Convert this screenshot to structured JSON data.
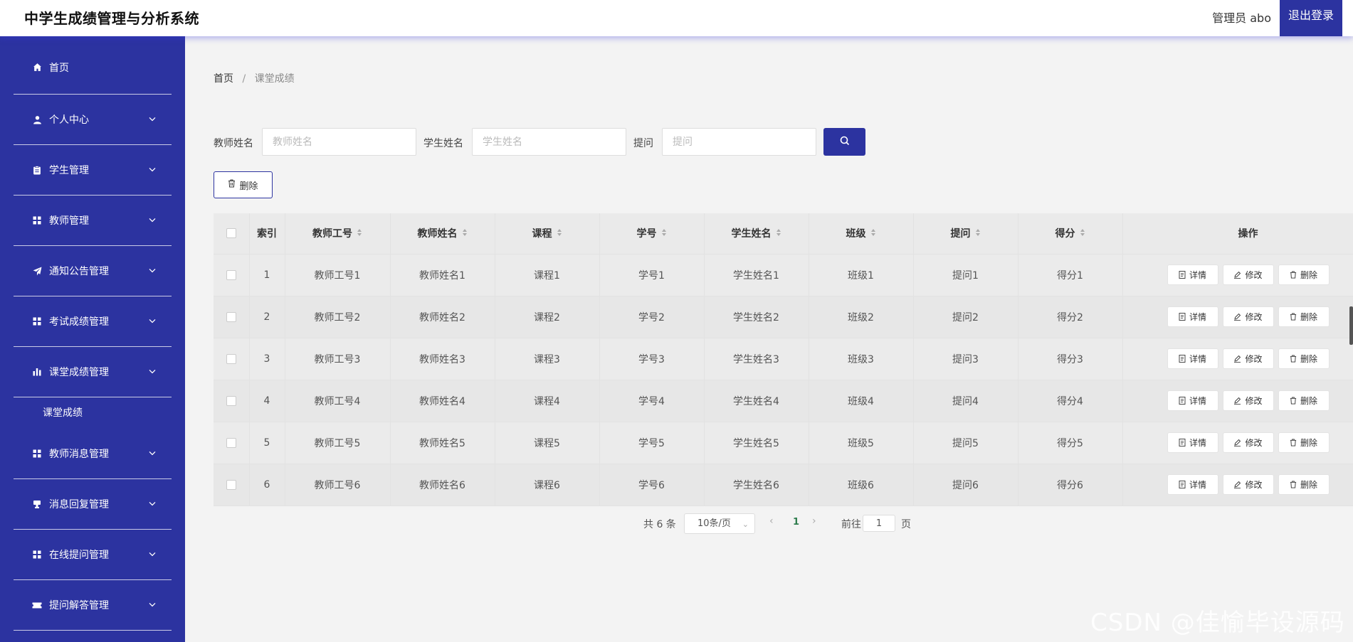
{
  "header": {
    "title": "中学生成绩管理与分析系统",
    "admin_label": "管理员 abo",
    "logout_label": "退出登录"
  },
  "sidebar": {
    "items": [
      {
        "label": "首页",
        "icon": "home-icon"
      },
      {
        "label": "个人中心",
        "icon": "user-icon"
      },
      {
        "label": "学生管理",
        "icon": "clipboard-icon"
      },
      {
        "label": "教师管理",
        "icon": "grid-icon"
      },
      {
        "label": "通知公告管理",
        "icon": "send-icon"
      },
      {
        "label": "考试成绩管理",
        "icon": "grid-icon"
      },
      {
        "label": "课堂成绩管理",
        "icon": "bar-chart-icon"
      },
      {
        "label": "教师消息管理",
        "icon": "grid-icon"
      },
      {
        "label": "消息回复管理",
        "icon": "stamp-icon"
      },
      {
        "label": "在线提问管理",
        "icon": "grid-icon"
      },
      {
        "label": "提问解答管理",
        "icon": "ticket-icon"
      }
    ],
    "submenu_label": "课堂成绩"
  },
  "breadcrumb": {
    "home": "首页",
    "separator": "/",
    "current": "课堂成绩"
  },
  "search": {
    "teacher_label": "教师姓名",
    "teacher_placeholder": "教师姓名",
    "student_label": "学生姓名",
    "student_placeholder": "学生姓名",
    "question_label": "提问",
    "question_placeholder": "提问"
  },
  "toolbar": {
    "delete_label": "删除"
  },
  "table": {
    "headers": [
      "索引",
      "教师工号",
      "教师姓名",
      "课程",
      "学号",
      "学生姓名",
      "班级",
      "提问",
      "得分",
      "操作"
    ],
    "rows": [
      [
        "1",
        "教师工号1",
        "教师姓名1",
        "课程1",
        "学号1",
        "学生姓名1",
        "班级1",
        "提问1",
        "得分1"
      ],
      [
        "2",
        "教师工号2",
        "教师姓名2",
        "课程2",
        "学号2",
        "学生姓名2",
        "班级2",
        "提问2",
        "得分2"
      ],
      [
        "3",
        "教师工号3",
        "教师姓名3",
        "课程3",
        "学号3",
        "学生姓名3",
        "班级3",
        "提问3",
        "得分3"
      ],
      [
        "4",
        "教师工号4",
        "教师姓名4",
        "课程4",
        "学号4",
        "学生姓名4",
        "班级4",
        "提问4",
        "得分4"
      ],
      [
        "5",
        "教师工号5",
        "教师姓名5",
        "课程5",
        "学号5",
        "学生姓名5",
        "班级5",
        "提问5",
        "得分5"
      ],
      [
        "6",
        "教师工号6",
        "教师姓名6",
        "课程6",
        "学号6",
        "学生姓名6",
        "班级6",
        "提问6",
        "得分6"
      ]
    ],
    "actions": {
      "detail": "详情",
      "edit": "修改",
      "delete": "删除"
    }
  },
  "pagination": {
    "total": "共 6 条",
    "page_size": "10条/页",
    "current_page": "1",
    "goto_label": "前往",
    "jump_value": "1",
    "page_suffix": "页"
  },
  "watermark": "CSDN @佳愉毕设源码",
  "colors": {
    "accent": "#2c33a0",
    "page_bg": "#f3f3f3",
    "current_page": "#2f7d4e"
  }
}
